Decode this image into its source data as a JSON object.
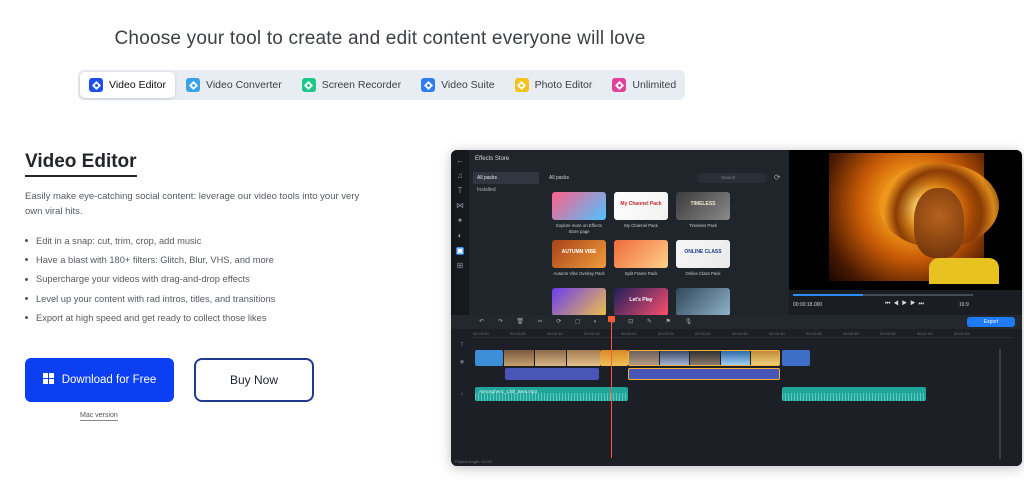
{
  "headline": "Choose your tool to create and edit content everyone will love",
  "tabs": [
    {
      "label": "Video Editor",
      "color": "#1d4ef0",
      "active": true
    },
    {
      "label": "Video Converter",
      "color": "#3aa0e8"
    },
    {
      "label": "Screen Recorder",
      "color": "#1cc88a"
    },
    {
      "label": "Video Suite",
      "color": "#2f7df0"
    },
    {
      "label": "Photo Editor",
      "color": "#f4c21c"
    },
    {
      "label": "Unlimited",
      "color": "#e0419a"
    }
  ],
  "section": {
    "title": "Video Editor",
    "description": "Easily make eye-catching social content: leverage our video tools into your very own viral hits.",
    "features": [
      "Edit in a snap: cut, trim, crop, add music",
      "Have a blast with 180+ filters: Glitch, Blur, VHS, and more",
      "Supercharge your videos with drag-and-drop effects",
      "Level up your content with rad intros, titles, and transitions",
      "Export at high speed and get ready to collect those likes"
    ]
  },
  "cta": {
    "download_label": "Download for Free",
    "buy_label": "Buy Now",
    "mac_link": "Mac version"
  },
  "app": {
    "store_title": "Effects Store",
    "side_items": [
      "All packs",
      "Installed"
    ],
    "packs_heading": "All packs",
    "search_placeholder": "Search",
    "packs": [
      {
        "label": "Explore more on Effects Store page",
        "colors": [
          "#ff5f8a",
          "#4dc4ff"
        ]
      },
      {
        "label": "My Channel Pack",
        "colors": [
          "#ffffff",
          "#f1f1f1"
        ]
      },
      {
        "label": "Timeless Pack",
        "colors": [
          "#3b3b3b",
          "#8a8a8a"
        ]
      },
      {
        "label": "Autumn Vibe Overlay Pack",
        "colors": [
          "#a7431a",
          "#f19b3a"
        ]
      },
      {
        "label": "Split Frame Pack",
        "colors": [
          "#f06a3a",
          "#ffd08a"
        ]
      },
      {
        "label": "Online Class Pack",
        "colors": [
          "#f8f8f8",
          "#e9e9e9"
        ]
      },
      {
        "label": "",
        "colors": [
          "#6a3cf0",
          "#f0c04a"
        ]
      },
      {
        "label": "",
        "colors": [
          "#1d1f5a",
          "#ff4f6e"
        ]
      },
      {
        "label": "",
        "colors": [
          "#30485a",
          "#8fb3c9"
        ]
      }
    ],
    "pack_titles": [
      "My Channel Pack",
      "TIMELESS",
      "AUTUMN VIBE",
      "ONLINE CLASS",
      "Let's Play"
    ],
    "timecode": "00:00:18.000",
    "ratio": "16:9",
    "export_label": "Export",
    "audio_clip_label": "Atmospheric_Chill_Beat.mp3",
    "project_length": "Project length: 01:00",
    "ruler_ticks": [
      "00:00:00",
      "00:00:05",
      "00:00:10",
      "00:00:15",
      "00:00:20",
      "00:00:25",
      "00:00:30",
      "00:00:35",
      "00:00:40",
      "00:00:45",
      "00:00:50",
      "00:00:55",
      "00:01:00",
      "00:01:05"
    ]
  }
}
